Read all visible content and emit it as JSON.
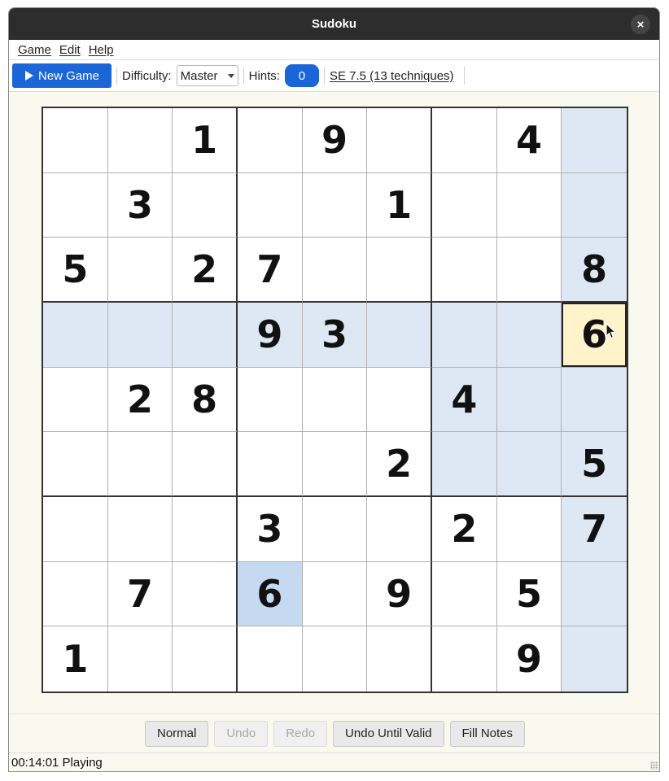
{
  "window": {
    "title": "Sudoku",
    "close_glyph": "×"
  },
  "menu": {
    "items": [
      "Game",
      "Edit",
      "Help"
    ]
  },
  "toolbar": {
    "new_game_label": "New Game",
    "difficulty_label": "Difficulty:",
    "difficulty_value": "Master",
    "hints_label": "Hints:",
    "hints_value": "0",
    "se_rating": "SE 7.5 (13 techniques)"
  },
  "board": {
    "grid": [
      [
        "",
        "",
        "1",
        "",
        "9",
        "",
        "",
        "4",
        ""
      ],
      [
        "",
        "3",
        "",
        "",
        "",
        "1",
        "",
        "",
        ""
      ],
      [
        "5",
        "",
        "2",
        "7",
        "",
        "",
        "",
        "",
        "8"
      ],
      [
        "",
        "",
        "",
        "9",
        "3",
        "",
        "",
        "",
        "6"
      ],
      [
        "",
        "2",
        "8",
        "",
        "",
        "",
        "4",
        "",
        ""
      ],
      [
        "",
        "",
        "",
        "",
        "",
        "2",
        "",
        "",
        "5"
      ],
      [
        "",
        "",
        "",
        "3",
        "",
        "",
        "2",
        "",
        "7"
      ],
      [
        "",
        "7",
        "",
        "6",
        "",
        "9",
        "",
        "5",
        ""
      ],
      [
        "1",
        "",
        "",
        "",
        "",
        "",
        "",
        "9",
        ""
      ]
    ],
    "selected": {
      "row": 3,
      "col": 8
    },
    "same_value_cells": [
      [
        7,
        3
      ]
    ],
    "colors": {
      "highlight": "#dde8f4",
      "same_value": "#c5d9f0",
      "selected": "#fff3cc"
    }
  },
  "bottom_buttons": [
    {
      "label": "Normal",
      "enabled": true
    },
    {
      "label": "Undo",
      "enabled": false
    },
    {
      "label": "Redo",
      "enabled": false
    },
    {
      "label": "Undo Until Valid",
      "enabled": true
    },
    {
      "label": "Fill Notes",
      "enabled": true
    }
  ],
  "status": {
    "text": "00:14:01 Playing"
  },
  "theme": {
    "accent": "#1a66d6",
    "titlebar": "#2d2d2d",
    "background": "#faf9f0"
  }
}
